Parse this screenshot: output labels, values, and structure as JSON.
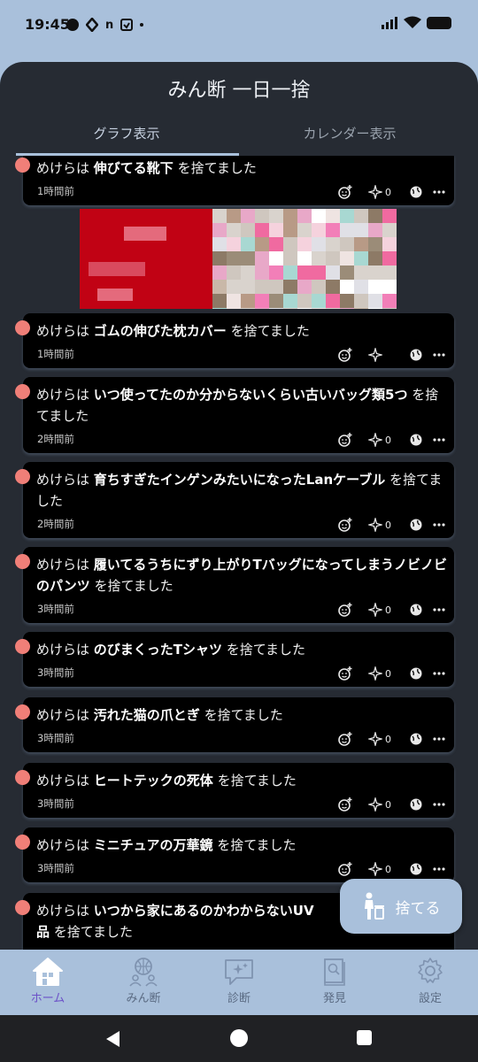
{
  "status": {
    "time": "19:45",
    "icon_letter_n": "n"
  },
  "app": {
    "title": "みん断 一日一捨"
  },
  "tabs": [
    {
      "label": "グラフ表示",
      "active": true
    },
    {
      "label": "カレンダー表示",
      "active": false
    }
  ],
  "posts": [
    {
      "user": "めけらは",
      "item": "伸びてる靴下",
      "suffix": " を捨てました",
      "time": "1時間前",
      "cheer_count": "0"
    },
    {
      "user": "めけらは",
      "item": "ゴムの伸びた枕カバー",
      "suffix": " を捨てました",
      "time": "1時間前",
      "cheer_count": ""
    },
    {
      "user": "めけらは",
      "item": "いつ使ってたのか分からないくらい古いバッグ類5つ",
      "suffix": " を捨てました",
      "time": "2時間前",
      "cheer_count": "0"
    },
    {
      "user": "めけらは",
      "item": "育ちすぎたインゲンみたいになったLanケーブル",
      "suffix": " を捨てました",
      "time": "2時間前",
      "cheer_count": "0"
    },
    {
      "user": "めけらは",
      "item": "履いてるうちにずり上がりTバッグになってしまうノビノビのパンツ",
      "suffix": " を捨てました",
      "time": "3時間前",
      "cheer_count": "0"
    },
    {
      "user": "めけらは",
      "item": "のびまくったTシャツ",
      "suffix": " を捨てました",
      "time": "3時間前",
      "cheer_count": "0"
    },
    {
      "user": "めけらは",
      "item": "汚れた猫の爪とぎ",
      "suffix": " を捨てました",
      "time": "3時間前",
      "cheer_count": "0"
    },
    {
      "user": "めけらは",
      "item": "ヒートテックの死体",
      "suffix": " を捨てました",
      "time": "3時間前",
      "cheer_count": "0"
    },
    {
      "user": "めけらは",
      "item": "ミニチュアの万華鏡",
      "suffix": " を捨てました",
      "time": "3時間前",
      "cheer_count": "0"
    },
    {
      "user": "めけらは",
      "item": "いつから家にあるのかわからないUV",
      "item_tail": "品",
      "suffix": " を捨てました",
      "time": "",
      "cheer_count": ""
    }
  ],
  "fab": {
    "label": "捨てる"
  },
  "nav": [
    {
      "label": "ホーム",
      "icon": "home-icon",
      "active": true
    },
    {
      "label": "みん断",
      "icon": "globe-people-icon",
      "active": false
    },
    {
      "label": "診断",
      "icon": "sparkle-chat-icon",
      "active": false
    },
    {
      "label": "発見",
      "icon": "book-search-icon",
      "active": false
    },
    {
      "label": "設定",
      "icon": "gear-icon",
      "active": false
    }
  ],
  "colors": {
    "accent": "#a9c0db",
    "pin": "#f07f78",
    "nav_active": "#6c51c8",
    "background": "#262b33"
  }
}
